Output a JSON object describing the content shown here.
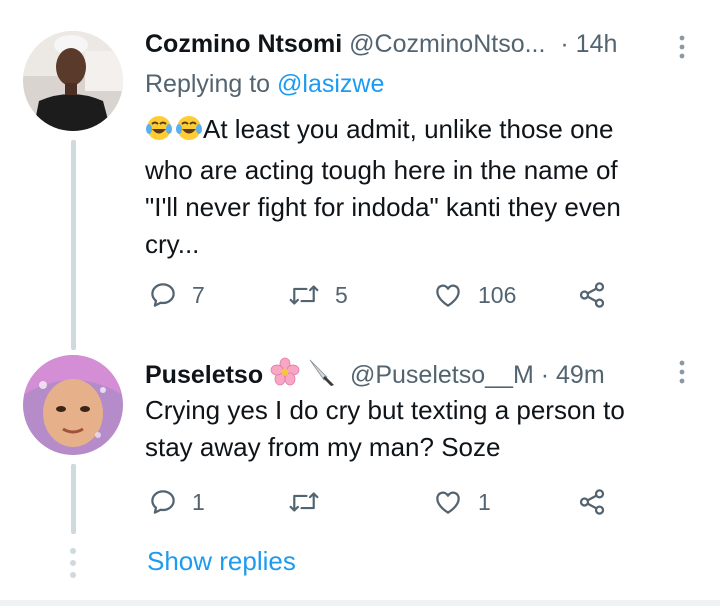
{
  "tweet1": {
    "name": "Cozmino Ntsomi",
    "handle": "@CozminoNtso...",
    "time": "· 14h",
    "replying_prefix": "Replying to",
    "replying_to": "@lasizwe",
    "text_line1": "At least you admit, unlike those one",
    "text_line2": "who are acting tough here in the name of",
    "text_line3": "\"I'll never fight for indoda\" kanti they even",
    "text_line4": "cry...",
    "emoji_prefix": "😂😂",
    "reply_count": "7",
    "retweet_count": "5",
    "like_count": "106"
  },
  "tweet2": {
    "name": "Puseletso",
    "handle": "@Puseletso__M",
    "time": "· 49m",
    "text_line1": "Crying yes I do cry but texting a person to",
    "text_line2": "stay away from my man? Soze",
    "reply_count": "1",
    "retweet_count": "",
    "like_count": "1"
  },
  "show_replies": "Show replies",
  "colors": {
    "accent": "#1d9bf0",
    "secondary_text": "#536471",
    "thread_line": "#cfd9de"
  },
  "icons": [
    "reply-icon",
    "retweet-icon",
    "like-icon",
    "share-icon",
    "more-icon",
    "cherry-blossom-emoji",
    "knife-emoji",
    "laughing-tears-emoji"
  ]
}
